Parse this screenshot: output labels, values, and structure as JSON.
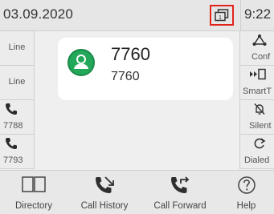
{
  "statusbar": {
    "date": "03.09.2020",
    "time": "9:22"
  },
  "left_keys": [
    {
      "label": "Line"
    },
    {
      "label": "Line"
    },
    {
      "label": "7788"
    },
    {
      "label": "7793"
    }
  ],
  "right_keys": [
    {
      "label": "Conf"
    },
    {
      "label": "SmartT"
    },
    {
      "label": "Silent"
    },
    {
      "label": "Dialed"
    }
  ],
  "contact": {
    "name": "7760",
    "number": "7760"
  },
  "bottom_keys": [
    {
      "label": "Directory"
    },
    {
      "label": "Call History"
    },
    {
      "label": "Call Forward"
    },
    {
      "label": "Help"
    }
  ],
  "colors": {
    "accent": "#23a85a",
    "highlight": "#e2231a",
    "background": "#efefef"
  }
}
